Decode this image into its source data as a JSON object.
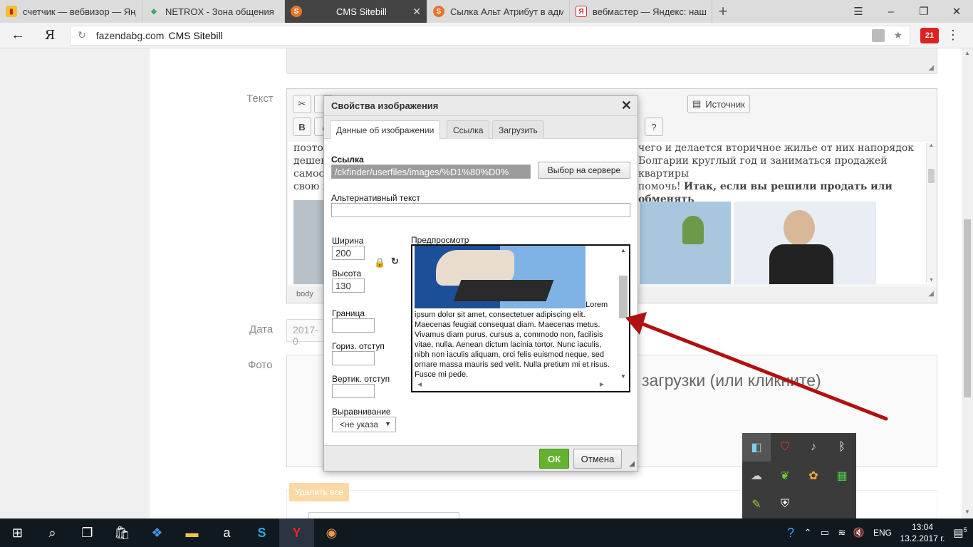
{
  "browser": {
    "tabs": [
      {
        "title": "счетчик — вебвизор — Янд",
        "icon": "bar-chart-icon",
        "active": false
      },
      {
        "title": "NETROX - Зона общения",
        "icon": "diamond-icon",
        "active": false
      },
      {
        "title": "CMS Sitebill",
        "icon": "sitebill-icon",
        "active": true
      },
      {
        "title": "Сылка Альт Атрибут в адми",
        "icon": "sitebill-icon",
        "active": false
      },
      {
        "title": "вебмастер — Яндекс: нашл",
        "icon": "yandex-icon",
        "active": false
      }
    ],
    "address": {
      "domain": "fazendabg.com",
      "page_title": "CMS Sitebill"
    },
    "ext_badge": "21",
    "colors": {
      "active_tab": "#444444",
      "tabbar": "#dcdcdc"
    }
  },
  "page": {
    "labels": {
      "text": "Текст",
      "date": "Дата",
      "photo": "Фото"
    },
    "editor": {
      "toolbar_source": "Источник",
      "bold": "B",
      "italic": "I",
      "help": "?",
      "content_left": "поэтом\nдешев\nсамост\nсвою н",
      "content_right_1": "чего и делается вторичное жилье от них напорядок",
      "content_right_2": "Болгарии круглый год и заниматься продажей квартиры",
      "content_right_3": "помочь!",
      "content_right_bold": "Итак, если вы решили продать или обменять",
      "status": "body"
    },
    "date_value": "2017-0",
    "photo_hint": "загрузки (или кликните)",
    "delete_all": "Удалить все",
    "accent": "#64b32e"
  },
  "dialog": {
    "title": "Свойства изображения",
    "tabs": [
      "Данные об изображении",
      "Ссылка",
      "Загрузить"
    ],
    "url_label": "Ссылка",
    "url_value": "/ckfinder/userfiles/images/%D1%80%D0%",
    "browse_server": "Выбор на сервере",
    "alt_label": "Альтернативный текст",
    "alt_value": "",
    "width_label": "Ширина",
    "width_value": "200",
    "height_label": "Высота",
    "height_value": "130",
    "border_label": "Граница",
    "hspace_label": "Гориз. отступ",
    "vspace_label": "Вертик. отступ",
    "align_label": "Выравнивание",
    "align_value": "<не указа",
    "preview_label": "Предпросмотр",
    "preview_text": "Lorem ipsum dolor sit amet, consectetuer adipiscing elit. Maecenas feugiat consequat diam. Maecenas metus. Vivamus diam purus, cursus a, commodo non, facilisis vitae, nulla. Aenean dictum lacinia tortor. Nunc iaculis, nibh non iaculis aliquam, orci felis euismod neque, sed ornare massa mauris sed velit. Nulla pretium mi et risus. Fusce mi pede.",
    "ok": "ОК",
    "cancel": "Отмена"
  },
  "taskbar": {
    "lang": "ENG",
    "time": "13:04",
    "date": "13.2.2017 г.",
    "notifications": "5"
  },
  "annotation_color": "#b01010"
}
